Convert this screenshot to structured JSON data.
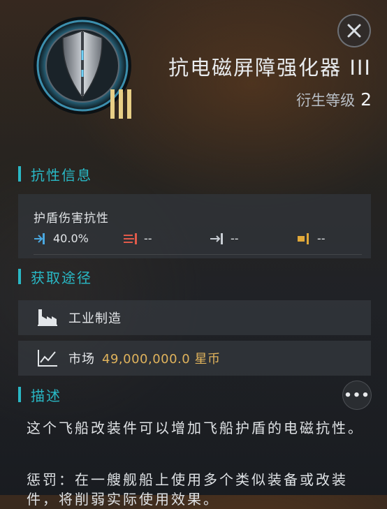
{
  "item": {
    "title": "抗电磁屏障强化器 III",
    "tier_mark": "III",
    "derive_label": "衍生等级",
    "derive_level": "2"
  },
  "sections": {
    "resistance": {
      "heading": "抗性信息",
      "title": "护盾伤害抗性",
      "values": [
        {
          "icon": "em-damage-icon",
          "value": "40.0%",
          "color": "#4aa8e0"
        },
        {
          "icon": "thermal-damage-icon",
          "value": "--",
          "color": "#e05a4a"
        },
        {
          "icon": "kinetic-damage-icon",
          "value": "--",
          "color": "#c9ced4"
        },
        {
          "icon": "explosive-damage-icon",
          "value": "--",
          "color": "#e0a83a"
        }
      ]
    },
    "acquire": {
      "heading": "获取途径",
      "industry_label": "工业制造",
      "market_label": "市场",
      "market_price": "49,000,000.0 星币"
    },
    "description": {
      "heading": "描述",
      "more_label": "•••",
      "paragraph1": "这个飞船改装件可以增加飞船护盾的电磁抗性。",
      "paragraph2": "惩罚：在一艘舰船上使用多个类似装备或改装件，将削弱实际使用效果。"
    }
  },
  "colors": {
    "accent": "#29b9c6",
    "price": "#e0b35c"
  }
}
